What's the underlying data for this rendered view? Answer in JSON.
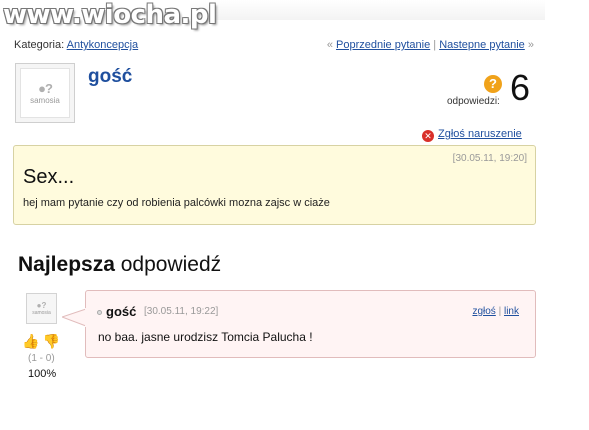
{
  "watermark": {
    "text": "www.wiocha.pl"
  },
  "header": {
    "category_label": "Kategoria:",
    "category_link": "Antykoncepcja",
    "prev_marker": "«",
    "prev_link": "Poprzednie pytanie",
    "separator": "|",
    "next_link": "Nastepne pytanie",
    "next_marker": "»"
  },
  "question": {
    "avatar_text": "samosia",
    "author": "gość",
    "answers_label": "odpowiedzi:",
    "answers_count": "6",
    "report_link": "Zgłoś naruszenie",
    "date": "[30.05.11, 19:20]",
    "title": "Sex...",
    "body": "hej mam pytanie czy od robienia palcówki mozna zajsc w ciaże"
  },
  "best_answer": {
    "heading_bold": "Najlepsza",
    "heading_rest": "odpowiedź",
    "avatar_text": "samosia",
    "votes": "(1 - 0)",
    "percent": "100%",
    "author": "gość",
    "date": "[30.05.11, 19:22]",
    "report_link": "zgłoś",
    "separator": "|",
    "permalink": "link",
    "body": "no baa. jasne urodzisz Tomcia Palucha !"
  },
  "colors": {
    "link": "#1f4f9e",
    "question_bg": "#fffbdd",
    "answer_bg": "#fff4f4",
    "badge_orange": "#f0a21a",
    "report_red": "#d9302a"
  }
}
